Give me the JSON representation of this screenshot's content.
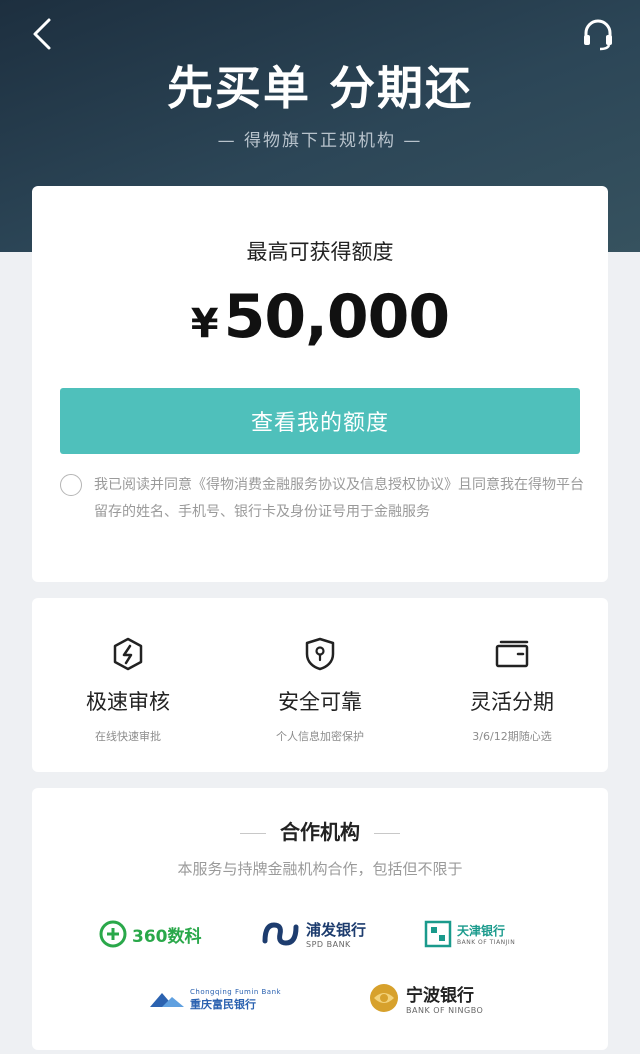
{
  "header": {
    "title": "先买单 分期还",
    "subtitle": "— 得物旗下正规机构 —"
  },
  "limit_card": {
    "label": "最高可获得额度",
    "currency": "¥",
    "amount": "50,000",
    "button_label": "查看我的额度",
    "agreement": {
      "prefix": "我已阅读并同意",
      "link_text": "《得物消费金融服务协议及信息授权协议》",
      "suffix": "且同意我在得物平台留存的姓名、手机号、银行卡及身份证号用于金融服务"
    }
  },
  "features": [
    {
      "icon": "lightning-shield-icon",
      "title": "极速审核",
      "subtitle": "在线快速审批"
    },
    {
      "icon": "security-shield-icon",
      "title": "安全可靠",
      "subtitle": "个人信息加密保护"
    },
    {
      "icon": "card-icon",
      "title": "灵活分期",
      "subtitle": "3/6/12期随心选"
    }
  ],
  "partners": {
    "title": "合作机构",
    "subtitle": "本服务与持牌金融机构合作，包括但不限于",
    "logos": [
      {
        "name": "360数科",
        "en": ""
      },
      {
        "name": "浦发银行",
        "en": "SPD BANK"
      },
      {
        "name": "天津银行",
        "en": "BANK OF TIANJIN"
      },
      {
        "name": "重庆富民银行",
        "en": "Chongqing Fumin Bank"
      },
      {
        "name": "宁波银行",
        "en": "BANK OF NINGBO"
      }
    ]
  },
  "colors": {
    "hero_dark": "#1d2f3f",
    "accent_teal": "#4fc0bb",
    "partner_green": "#2aa84a",
    "partner_navy": "#1d3c6e",
    "partner_teal": "#1a9a8c",
    "partner_blue": "#2b62b0",
    "partner_gold": "#d7a12c"
  }
}
